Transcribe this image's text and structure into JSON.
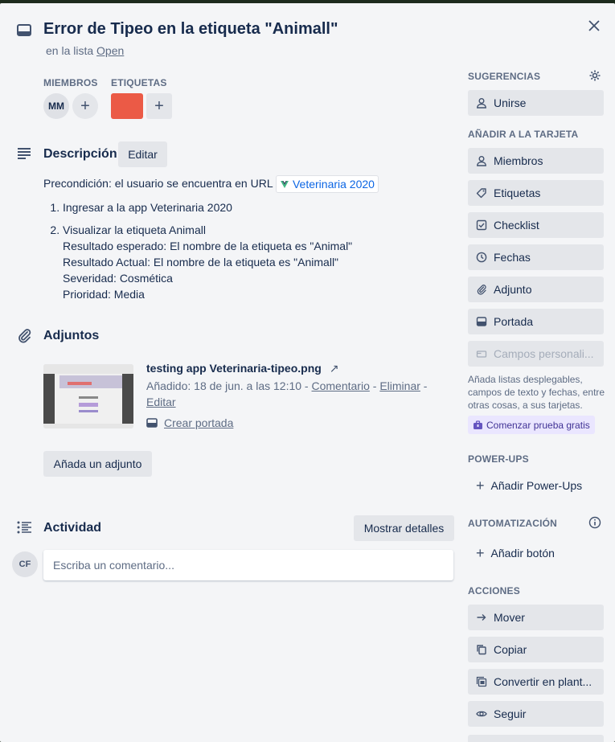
{
  "card": {
    "title": "Error de Tipeo en la etiqueta \"Animall\"",
    "in_list_prefix": "en la lista",
    "list_name": "Open"
  },
  "members": {
    "label": "MIEMBROS",
    "avatars": [
      "MM"
    ]
  },
  "labels": {
    "label": "ETIQUETAS",
    "colors": [
      "#eb5a46"
    ]
  },
  "description": {
    "title": "Descripción",
    "edit_label": "Editar",
    "precondition": "Precondición: el usuario se encuentra en URL",
    "url_chip": "Veterinaria 2020",
    "steps": [
      "Ingresar a la app Veterinaria 2020",
      "Visualizar la etiqueta Animall"
    ],
    "step2_details": [
      "Resultado esperado: El nombre de la etiqueta es \"Animal\"",
      "Resultado Actual: El nombre de la etiqueta es \"Animall\"",
      "Severidad: Cosmética",
      "Prioridad: Media"
    ]
  },
  "attachments": {
    "title": "Adjuntos",
    "file_name": "testing app Veterinaria-tipeo.png",
    "added": "Añadido: 18 de jun. a las 12:10",
    "comment_link": "Comentario",
    "delete_link": "Eliminar",
    "edit_link": "Editar",
    "make_cover": "Crear portada",
    "add_button": "Añada un adjunto"
  },
  "activity": {
    "title": "Actividad",
    "show_details": "Mostrar detalles",
    "comment_placeholder": "Escriba un comentario...",
    "user_avatar": "CF"
  },
  "sidebar": {
    "suggestions_label": "SUGERENCIAS",
    "join": "Unirse",
    "add_to_card_label": "AÑADIR A LA TARJETA",
    "add_items": [
      "Miembros",
      "Etiquetas",
      "Checklist",
      "Fechas",
      "Adjunto",
      "Portada"
    ],
    "custom_fields": "Campos personali...",
    "custom_help": "Añada listas desplegables, campos de texto y fechas, entre otras cosas, a sus tarjetas.",
    "trial": "Comenzar prueba gratis",
    "powerups_label": "POWER-UPS",
    "add_powerups": "Añadir Power-Ups",
    "automation_label": "AUTOMATIZACIÓN",
    "add_button": "Añadir botón",
    "actions_label": "ACCIONES",
    "actions": [
      "Mover",
      "Copiar",
      "Convertir en plant...",
      "Seguir"
    ]
  },
  "colors": {
    "label_red": "#eb5a46",
    "link_blue": "#0c66e4",
    "trial_purple": "#403294"
  }
}
